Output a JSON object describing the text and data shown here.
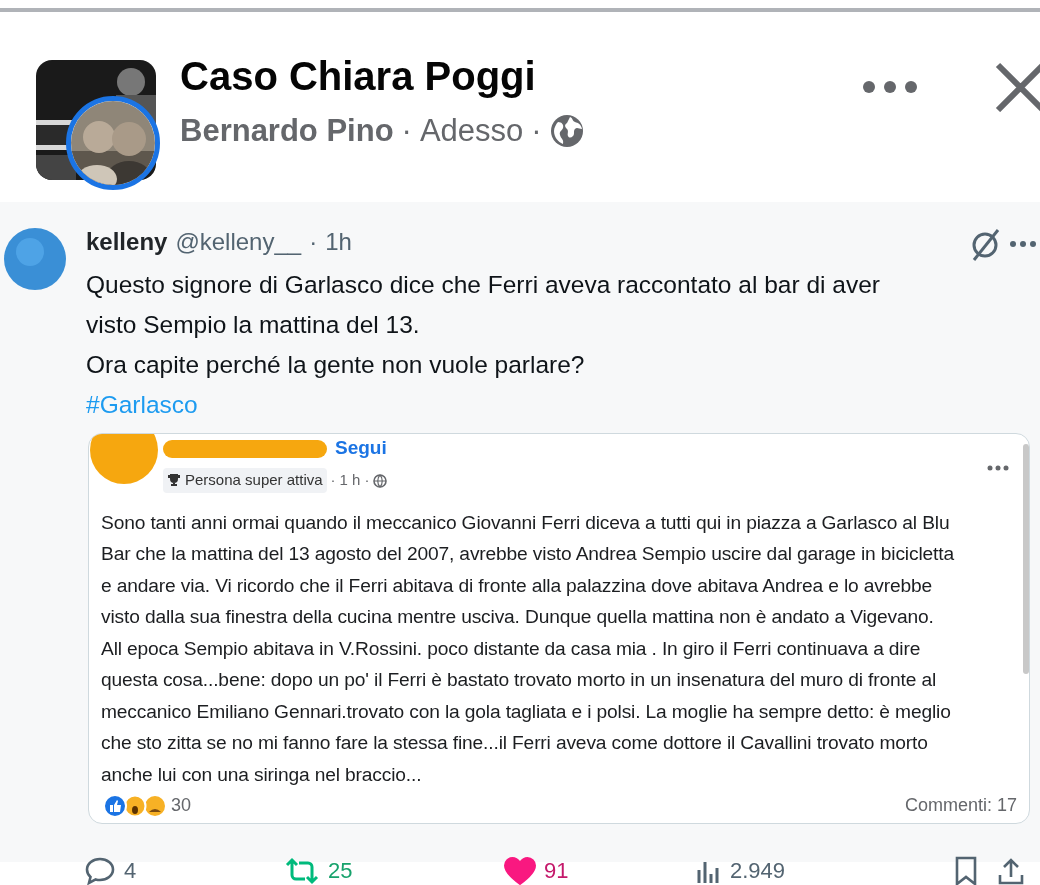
{
  "post_header": {
    "group_name": "Caso Chiara Poggi",
    "author": "Bernardo Pino",
    "separator_1": "·",
    "time": "Adesso",
    "separator_2": "·"
  },
  "tweet": {
    "display_name": "kelleny",
    "handle": "@kelleny__",
    "separator": "·",
    "time": "1h",
    "text": "Questo signore di Garlasco dice che Ferri aveva raccontato al bar di aver\nvisto Sempio la mattina del 13.\nOra capite perché la gente non vuole parlare?",
    "hashtag": "#Garlasco",
    "quoted_post": {
      "follow": "Segui",
      "badge": "Persona super attiva",
      "separator_1": "·",
      "time": "1 h",
      "separator_2": "·",
      "text": "Sono tanti anni ormai quando il meccanico Giovanni Ferri diceva a tutti qui in piazza a Garlasco al Blu\nBar che la mattina del 13 agosto del 2007, avrebbe visto Andrea Sempio uscire dal garage in bicicletta\ne andare via. Vi ricordo che il Ferri abitava di fronte alla palazzina dove abitava Andrea e lo avrebbe\nvisto dalla sua finestra della cucina mentre usciva. Dunque quella mattina non è andato a Vigevano.\nAll epoca Sempio abitava in V.Rossini. poco distante da casa mia . In giro il Ferri continuava a dire\nquesta cosa...bene: dopo un po' il Ferri è bastato trovato morto in un insenatura del muro di fronte al\nmeccanico Emiliano Gennari.trovato con la gola tagliata e i polsi. La moglie ha sempre detto: è meglio\nche sto zitta se no mi fanno fare la stessa fine...il Ferri aveva come dottore il Cavallini trovato morto\nanche lui con una siringa nel braccio...",
      "reaction_count": "30",
      "comments": "Commenti: 17"
    },
    "actions": [
      {
        "kind": "reply",
        "count": "4",
        "active": false
      },
      {
        "kind": "repost",
        "count": "25",
        "active": true
      },
      {
        "kind": "like",
        "count": "91",
        "active": true
      },
      {
        "kind": "views",
        "count": "2.949"
      }
    ]
  }
}
